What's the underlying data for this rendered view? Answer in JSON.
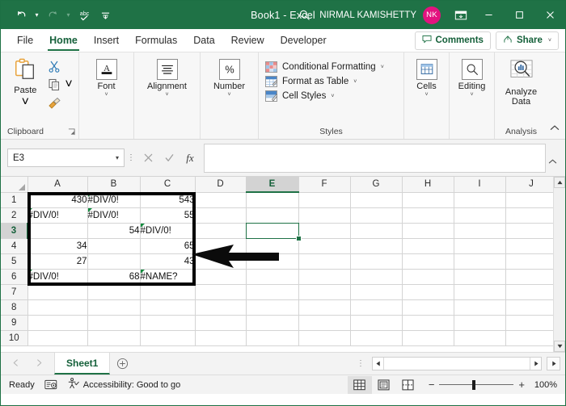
{
  "titlebar": {
    "title": "Book1  -  Excel",
    "user": "NIRMAL KAMISHETTY",
    "avatar_initials": "NK",
    "undo_icon": "undo-arrow",
    "redo_icon": "redo-arrow",
    "spelling_icon": "abc-check",
    "customize_icon": "chevron-down-bar",
    "search_icon": "magnifier",
    "ribbon_display_icon": "ribbon-display-options",
    "minimize_label": "—",
    "maximize_label": "☐",
    "close_label": "✕",
    "accent_green": "#1f7246",
    "avatar_color": "#e3137f"
  },
  "tabs": [
    {
      "label": "File",
      "active": false
    },
    {
      "label": "Home",
      "active": true
    },
    {
      "label": "Insert",
      "active": false
    },
    {
      "label": "Formulas",
      "active": false
    },
    {
      "label": "Data",
      "active": false
    },
    {
      "label": "Review",
      "active": false
    },
    {
      "label": "Developer",
      "active": false
    }
  ],
  "tab_right": {
    "comments_label": "Comments",
    "comments_icon": "comment-bubble",
    "share_label": "Share",
    "share_icon": "share-person",
    "share_caret": "˅"
  },
  "ribbon": {
    "clipboard": {
      "group_label": "Clipboard",
      "paste_label": "Paste",
      "paste_caret": "˅",
      "paste_icon": "clipboard",
      "cut_icon": "scissors",
      "copy_icon": "copy-pages",
      "copy_caret": "˅",
      "format_painter_icon": "paintbrush",
      "launcher_icon": "dialog-launcher"
    },
    "font": {
      "label": "Font",
      "caret": "˅",
      "icon": "font-letter-A"
    },
    "alignment": {
      "label": "Alignment",
      "caret": "˅",
      "icon": "align-lines"
    },
    "number": {
      "label": "Number",
      "caret": "˅",
      "icon": "percent-sign"
    },
    "styles": {
      "group_label": "Styles",
      "items": [
        {
          "label": "Conditional Formatting",
          "caret": "˅",
          "icon": "conditional-formatting-grid"
        },
        {
          "label": "Format as Table",
          "caret": "˅",
          "icon": "format-as-table"
        },
        {
          "label": "Cell Styles",
          "caret": "˅",
          "icon": "cell-styles"
        }
      ]
    },
    "cells": {
      "label": "Cells",
      "caret": "˅",
      "icon": "cells-table"
    },
    "editing": {
      "label": "Editing",
      "caret": "˅",
      "icon": "magnifier"
    },
    "analysis": {
      "group_label": "Analysis",
      "label_line1": "Analyze",
      "label_line2": "Data",
      "icon": "analyze-data-chart"
    },
    "collapse_icon": "chevron-up"
  },
  "formula_bar": {
    "name_box_value": "E3",
    "name_box_caret": "˅",
    "cancel_icon": "cancel-x",
    "enter_icon": "check",
    "fx_label": "fx",
    "formula_value": "",
    "expand_icon": "chevron-up"
  },
  "grid": {
    "columns": [
      "A",
      "B",
      "C",
      "D",
      "E",
      "F",
      "G",
      "H",
      "I",
      "J"
    ],
    "selected_column": "E",
    "rows": [
      "1",
      "2",
      "3",
      "4",
      "5",
      "6",
      "7",
      "8",
      "9",
      "10"
    ],
    "selected_row": "3",
    "selected_cell": "E3",
    "cells": [
      [
        {
          "v": "430",
          "err": false,
          "tri": false
        },
        {
          "v": "#DIV/0!",
          "err": true,
          "tri": true
        },
        {
          "v": "543",
          "err": false,
          "tri": false
        }
      ],
      [
        {
          "v": "#DIV/0!",
          "err": true,
          "tri": true
        },
        {
          "v": "#DIV/0!",
          "err": true,
          "tri": true
        },
        {
          "v": "55",
          "err": false,
          "tri": false
        }
      ],
      [
        {
          "v": "",
          "err": false,
          "tri": false
        },
        {
          "v": "54",
          "err": false,
          "tri": false
        },
        {
          "v": "#DIV/0!",
          "err": true,
          "tri": true
        }
      ],
      [
        {
          "v": "34",
          "err": false,
          "tri": false
        },
        {
          "v": "",
          "err": false,
          "tri": false
        },
        {
          "v": "65",
          "err": false,
          "tri": false
        }
      ],
      [
        {
          "v": "27",
          "err": false,
          "tri": false
        },
        {
          "v": "",
          "err": false,
          "tri": false
        },
        {
          "v": "43",
          "err": false,
          "tri": false
        }
      ],
      [
        {
          "v": "#DIV/0!",
          "err": true,
          "tri": true
        },
        {
          "v": "68",
          "err": false,
          "tri": false
        },
        {
          "v": "#NAME?",
          "err": true,
          "tri": true
        }
      ]
    ],
    "highlight_box_range": "A1:C6",
    "annotation_arrow": "black-left-arrow"
  },
  "sheet_tabs": {
    "prev_icon": "◄",
    "next_icon": "►",
    "sheets": [
      "Sheet1"
    ],
    "active_sheet": "Sheet1",
    "add_sheet_icon": "⊕"
  },
  "hscroll": {
    "left_icon": "◄",
    "right_icon": "►",
    "end_icon": "►"
  },
  "vscroll": {
    "up_icon": "▲",
    "down_icon": "▼"
  },
  "statusbar": {
    "mode": "Ready",
    "record_macro_icon": "record-macro",
    "accessibility_icon": "accessibility-person",
    "accessibility_text": "Accessibility: Good to go",
    "view_normal_icon": "normal-view-grid",
    "view_pagelayout_icon": "page-layout",
    "view_pagebreak_icon": "page-break-preview",
    "zoom_out": "−",
    "zoom_in": "+",
    "zoom_value": "100%"
  }
}
